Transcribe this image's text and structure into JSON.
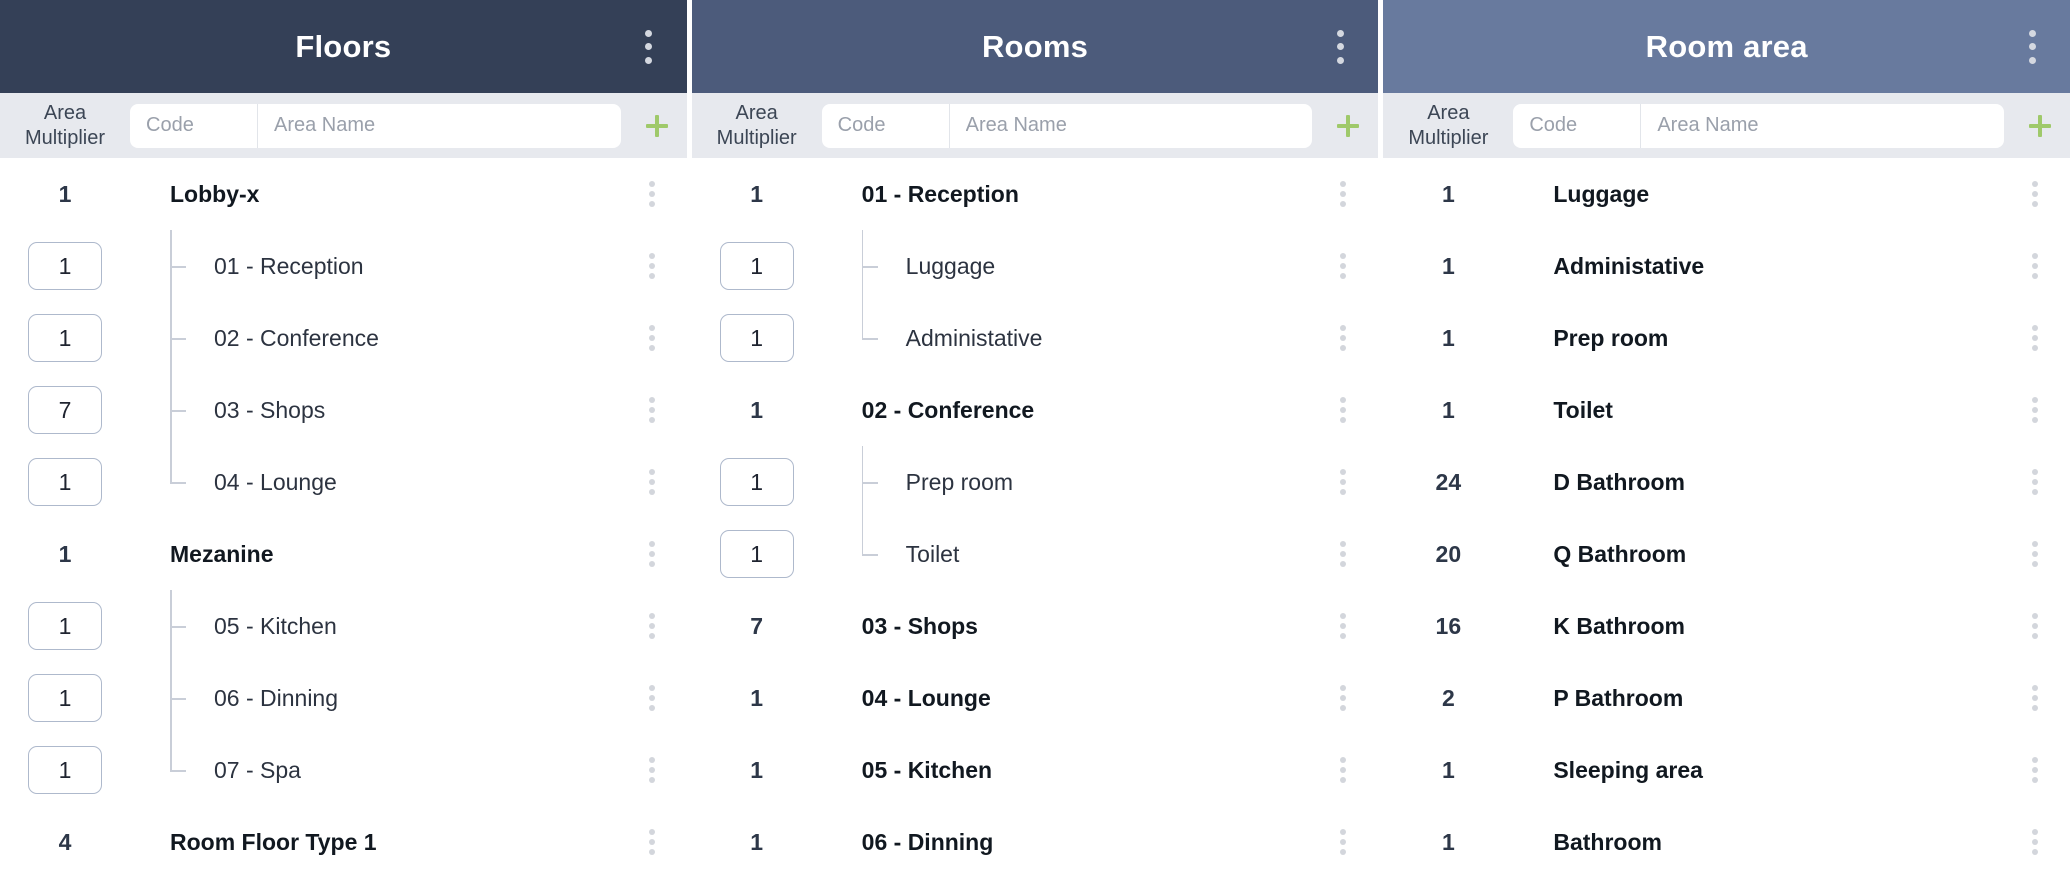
{
  "panels": [
    {
      "title": "Floors",
      "header_color": "#344057",
      "menu_icon": "kebab-menu-icon",
      "toolbar": {
        "multiplier_label": "Area\nMultiplier",
        "multiplier_label_line1": "Area",
        "multiplier_label_line2": "Multiplier",
        "code_placeholder": "Code",
        "code_value": "",
        "name_placeholder": "Area Name",
        "name_value": "",
        "add_label": "+",
        "add_icon": "plus-icon",
        "add_color": "#9fc96a"
      },
      "rows": [
        {
          "multiplier": "1",
          "label": "Lobby-x",
          "type": "parent"
        },
        {
          "multiplier": "1",
          "label": "01 - Reception",
          "type": "child",
          "last": false
        },
        {
          "multiplier": "1",
          "label": "02 - Conference",
          "type": "child",
          "last": false
        },
        {
          "multiplier": "7",
          "label": "03 - Shops",
          "type": "child",
          "last": false
        },
        {
          "multiplier": "1",
          "label": "04 - Lounge",
          "type": "child",
          "last": true
        },
        {
          "multiplier": "1",
          "label": "Mezanine",
          "type": "parent"
        },
        {
          "multiplier": "1",
          "label": "05 - Kitchen",
          "type": "child",
          "last": false
        },
        {
          "multiplier": "1",
          "label": "06 - Dinning",
          "type": "child",
          "last": false
        },
        {
          "multiplier": "1",
          "label": "07 - Spa",
          "type": "child",
          "last": true
        },
        {
          "multiplier": "4",
          "label": "Room Floor Type 1",
          "type": "parent"
        }
      ]
    },
    {
      "title": "Rooms",
      "header_color": "#4c5b7b",
      "menu_icon": "kebab-menu-icon",
      "toolbar": {
        "multiplier_label_line1": "Area",
        "multiplier_label_line2": "Multiplier",
        "code_placeholder": "Code",
        "code_value": "",
        "name_placeholder": "Area Name",
        "name_value": "",
        "add_label": "+",
        "add_icon": "plus-icon",
        "add_color": "#9fc96a"
      },
      "rows": [
        {
          "multiplier": "1",
          "label": "01 - Reception",
          "type": "parent"
        },
        {
          "multiplier": "1",
          "label": "Luggage",
          "type": "child",
          "last": false
        },
        {
          "multiplier": "1",
          "label": "Administative",
          "type": "child",
          "last": true
        },
        {
          "multiplier": "1",
          "label": "02 - Conference",
          "type": "parent"
        },
        {
          "multiplier": "1",
          "label": "Prep room",
          "type": "child",
          "last": false
        },
        {
          "multiplier": "1",
          "label": "Toilet",
          "type": "child",
          "last": true
        },
        {
          "multiplier": "7",
          "label": "03 - Shops",
          "type": "parent"
        },
        {
          "multiplier": "1",
          "label": "04 - Lounge",
          "type": "parent"
        },
        {
          "multiplier": "1",
          "label": "05 - Kitchen",
          "type": "parent"
        },
        {
          "multiplier": "1",
          "label": "06 - Dinning",
          "type": "parent"
        }
      ]
    },
    {
      "title": "Room area",
      "header_color": "#687a9e",
      "menu_icon": "kebab-menu-icon",
      "toolbar": {
        "multiplier_label_line1": "Area",
        "multiplier_label_line2": "Multiplier",
        "code_placeholder": "Code",
        "code_value": "",
        "name_placeholder": "Area Name",
        "name_value": "",
        "add_label": "+",
        "add_icon": "plus-icon",
        "add_color": "#9fc96a"
      },
      "rows": [
        {
          "multiplier": "1",
          "label": "Luggage",
          "type": "parent"
        },
        {
          "multiplier": "1",
          "label": "Administative",
          "type": "parent"
        },
        {
          "multiplier": "1",
          "label": "Prep room",
          "type": "parent"
        },
        {
          "multiplier": "1",
          "label": "Toilet",
          "type": "parent"
        },
        {
          "multiplier": "24",
          "label": "D Bathroom",
          "type": "parent"
        },
        {
          "multiplier": "20",
          "label": "Q Bathroom",
          "type": "parent"
        },
        {
          "multiplier": "16",
          "label": "K Bathroom",
          "type": "parent"
        },
        {
          "multiplier": "2",
          "label": "P Bathroom",
          "type": "parent"
        },
        {
          "multiplier": "1",
          "label": "Sleeping area",
          "type": "parent"
        },
        {
          "multiplier": "1",
          "label": "Bathroom",
          "type": "parent"
        }
      ]
    }
  ]
}
